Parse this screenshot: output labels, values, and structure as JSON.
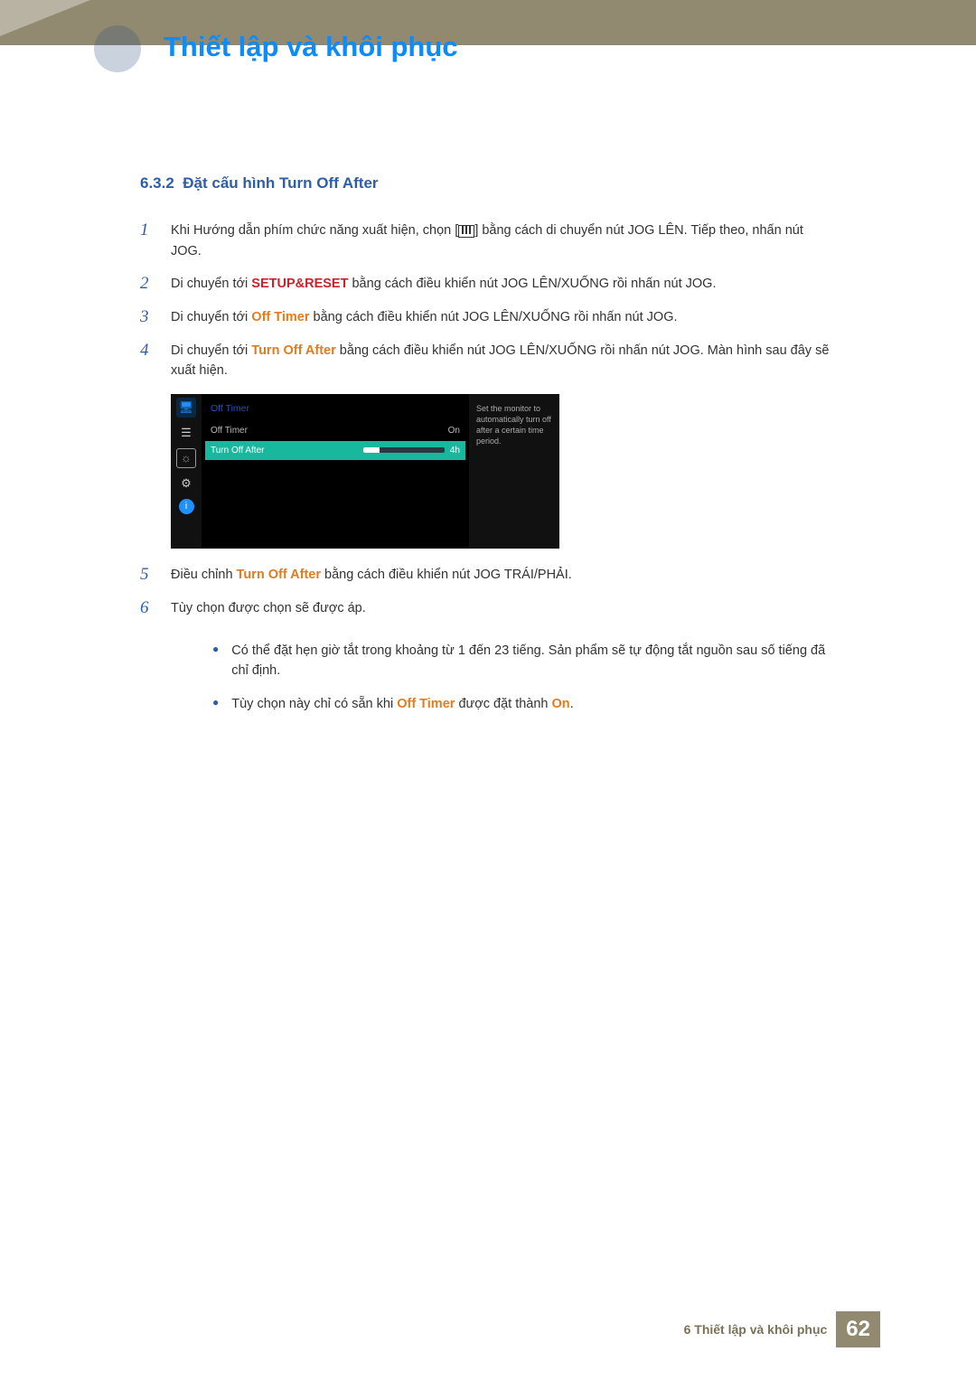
{
  "header": {
    "title": "Thiết lập và khôi phục"
  },
  "section": {
    "number": "6.3.2",
    "title": "Đặt cấu hình Turn Off After"
  },
  "steps": {
    "s1a": "Khi Hướng dẫn phím chức năng xuất hiện, chọn [",
    "s1b": "] bằng cách di chuyển nút JOG LÊN. Tiếp theo, nhấn nút JOG.",
    "s2a": "Di chuyển tới ",
    "s2_bold": "SETUP&RESET",
    "s2b": " bằng cách điều khiển nút JOG LÊN/XUỐNG rồi nhấn nút JOG.",
    "s3a": "Di chuyển tới ",
    "s3_bold": "Off Timer",
    "s3b": " bằng cách điều khiển nút JOG LÊN/XUỐNG rồi nhấn nút JOG.",
    "s4a": "Di chuyển tới ",
    "s4_bold": "Turn Off After",
    "s4b": " bằng cách điều khiển nút JOG LÊN/XUỐNG rồi nhấn nút JOG. Màn hình sau đây sẽ xuất hiện.",
    "s5a": "Điều chỉnh ",
    "s5_bold": "Turn Off After",
    "s5b": " bằng cách điều khiển nút JOG TRÁI/PHẢI.",
    "s6": "Tùy chọn được chọn sẽ được áp."
  },
  "osd": {
    "head": "Off Timer",
    "row1_label": "Off Timer",
    "row1_value": "On",
    "row2_label": "Turn Off After",
    "row2_value": "4h",
    "desc": "Set the monitor to automatically turn off after a certain time period."
  },
  "notes": {
    "n1": "Có thể đặt hẹn giờ tắt trong khoảng từ 1 đến 23 tiếng. Sản phẩm sẽ tự động tắt nguồn sau số tiếng đã chỉ định.",
    "n2a": "Tùy chọn này chỉ có sẵn khi ",
    "n2_bold1": "Off Timer",
    "n2b": " được đặt thành ",
    "n2_bold2": "On",
    "n2c": "."
  },
  "footer": {
    "chapter_label": "6 Thiết lập và khôi phục",
    "page": "62"
  }
}
